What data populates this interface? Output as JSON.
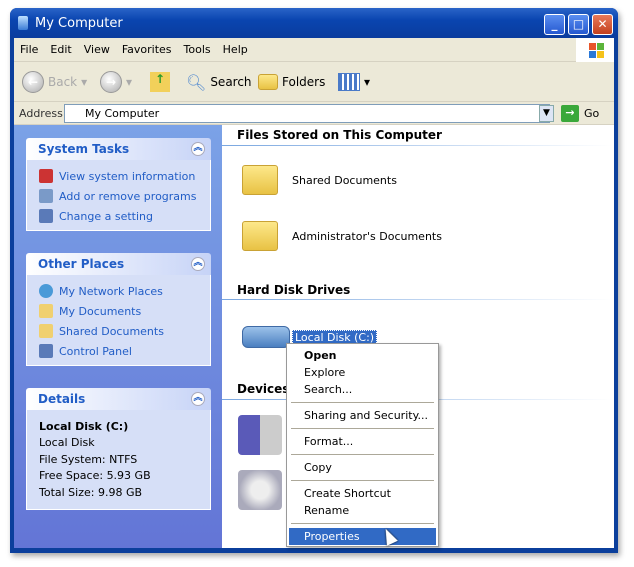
{
  "window": {
    "title": "My Computer"
  },
  "menu": [
    "File",
    "Edit",
    "View",
    "Favorites",
    "Tools",
    "Help"
  ],
  "toolbar": {
    "back": "Back",
    "search": "Search",
    "folders": "Folders"
  },
  "address": {
    "label": "Address",
    "value": "My Computer",
    "go": "Go"
  },
  "system_tasks": {
    "title": "System Tasks",
    "items": [
      "View system information",
      "Add or remove programs",
      "Change a setting"
    ]
  },
  "other_places": {
    "title": "Other Places",
    "items": [
      "My Network Places",
      "My Documents",
      "Shared Documents",
      "Control Panel"
    ]
  },
  "details": {
    "title": "Details",
    "name": "Local Disk (C:)",
    "type": "Local Disk",
    "fs": "File System: NTFS",
    "free": "Free Space: 5.93 GB",
    "total": "Total Size: 9.98 GB"
  },
  "sections": {
    "files": "Files Stored on This Computer",
    "hdd": "Hard Disk Drives",
    "devices": "Devices"
  },
  "files": [
    "Shared Documents",
    "Administrator's Documents"
  ],
  "drive": "Local Disk (C:)",
  "context_menu": {
    "open": "Open",
    "explore": "Explore",
    "search": "Search...",
    "sharing": "Sharing and Security...",
    "format": "Format...",
    "copy": "Copy",
    "shortcut": "Create Shortcut",
    "rename": "Rename",
    "properties": "Properties"
  }
}
